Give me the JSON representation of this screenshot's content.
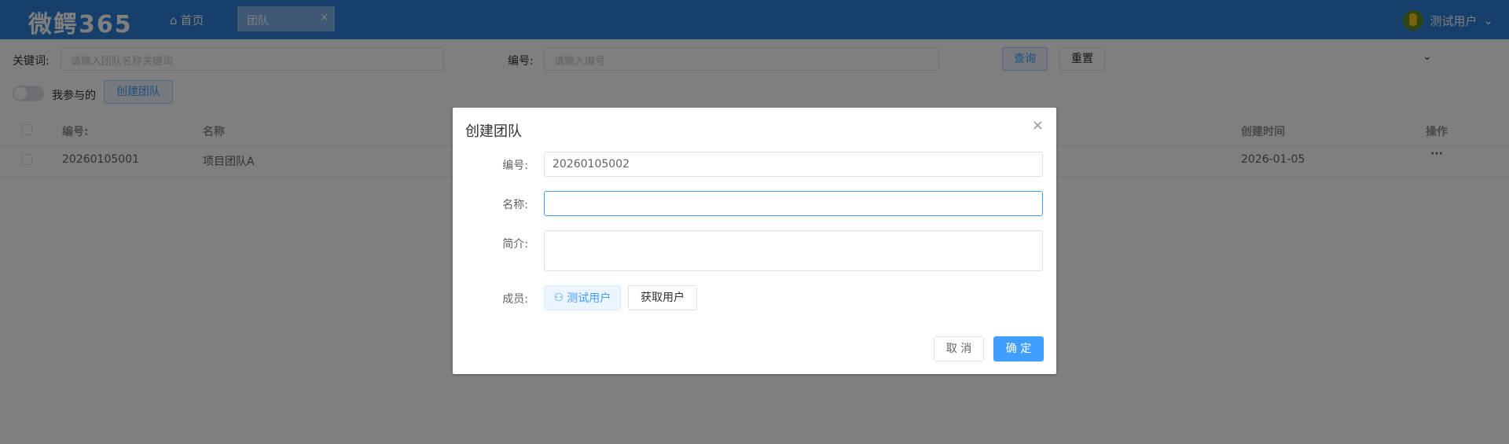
{
  "header": {
    "logo": "微鳄365",
    "home_label": "首页",
    "tab_label": "团队",
    "tab_close": "×",
    "user_name": "测试用户",
    "user_menu_icon": "chevron-down-icon"
  },
  "filters": {
    "keyword_label": "关键词:",
    "keyword_placeholder": "请输入团队名称关键词",
    "code_label": "编号:",
    "code_placeholder": "请输入编号",
    "query_button": "查询",
    "reset_button": "重置",
    "my_joined_label": "我参与的",
    "create_team_button": "创建团队"
  },
  "table": {
    "columns": [
      "编号:",
      "名称",
      "创建时间",
      "操作"
    ],
    "rows": [
      {
        "code": "20260105001",
        "name": "项目团队A",
        "created": "2026-01-05",
        "actions": "···"
      }
    ]
  },
  "dialog": {
    "title": "创建团队",
    "close": "×",
    "code_label": "编号:",
    "code_value": "20260105002",
    "name_label": "名称:",
    "name_value": "",
    "intro_label": "简介:",
    "intro_value": "",
    "members_label": "成员:",
    "member_tag": "测试用户",
    "fetch_users_button": "获取用户",
    "cancel_button": "取 消",
    "confirm_button": "确 定"
  },
  "colors": {
    "header_bg": "#2f7fd8",
    "primary": "#409eff",
    "mask": "rgba(0,0,0,0.5)"
  }
}
